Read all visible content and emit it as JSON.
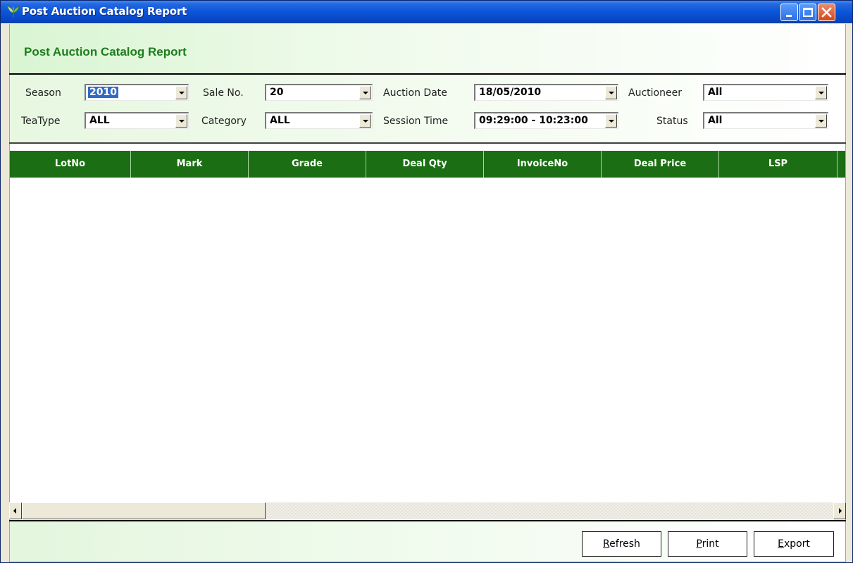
{
  "window": {
    "title": "Post Auction Catalog Report",
    "controls": {
      "minimize": "minimize-icon",
      "maximize": "maximize-icon",
      "close": "close-icon"
    }
  },
  "header": {
    "title": "Post Auction Catalog Report"
  },
  "filters": {
    "season": {
      "label": "Season",
      "value": "2010"
    },
    "sale_no": {
      "label": "Sale No.",
      "value": "20"
    },
    "auction_date": {
      "label": "Auction Date",
      "value": "18/05/2010"
    },
    "auctioneer": {
      "label": "Auctioneer",
      "value": "All"
    },
    "tea_type": {
      "label": "TeaType",
      "value": "ALL"
    },
    "category": {
      "label": "Category",
      "value": "ALL"
    },
    "session_time": {
      "label": "Session Time",
      "value": "09:29:00 - 10:23:00"
    },
    "status": {
      "label": "Status",
      "value": "All"
    }
  },
  "grid": {
    "columns": [
      "LotNo",
      "Mark",
      "Grade",
      "Deal Qty",
      "InvoiceNo",
      "Deal Price",
      "LSP"
    ],
    "rows": []
  },
  "footer": {
    "refresh": {
      "first": "R",
      "rest": "efresh"
    },
    "print": {
      "first": "P",
      "rest": "rint"
    },
    "export": {
      "first": "E",
      "rest": "xport"
    }
  },
  "colors": {
    "title_bar": "#0a55d8",
    "header_text": "#1d7d1d",
    "grid_header": "#1b6e14",
    "selection": "#316ac5"
  }
}
